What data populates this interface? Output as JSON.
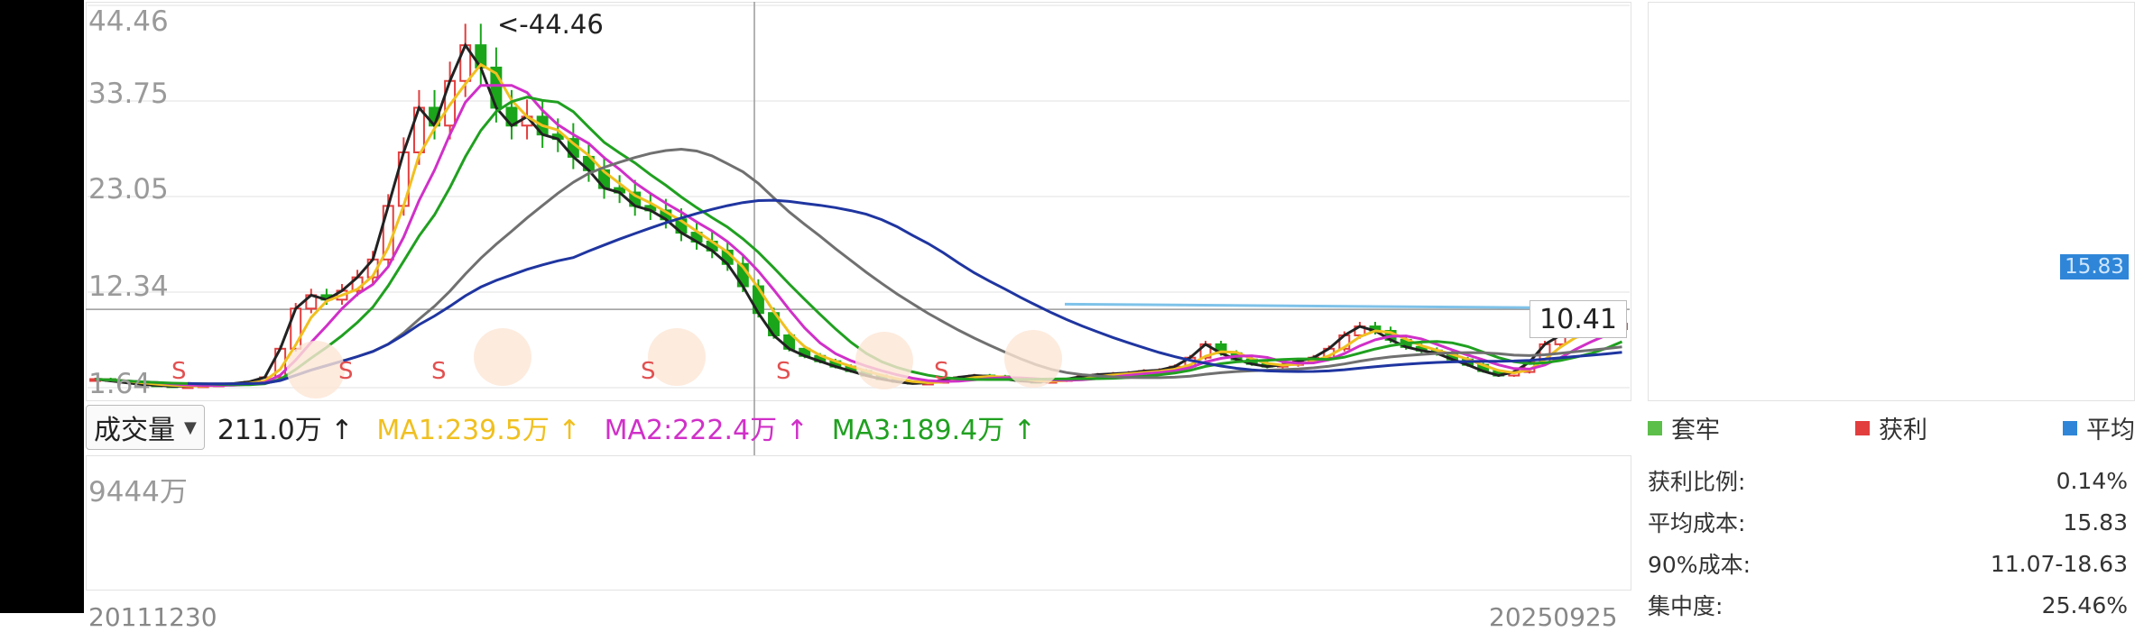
{
  "price_axis": {
    "ticks": [
      "44.46",
      "33.75",
      "23.05",
      "12.34",
      "1.64"
    ],
    "values": [
      44.46,
      33.75,
      23.05,
      12.34,
      1.64
    ]
  },
  "labels": {
    "high_marker": "<-44.46",
    "low_marker": "1.64->",
    "current_price": "10.41",
    "avg_cost_tag": "15.83"
  },
  "volume_toolbar": {
    "selector": "成交量",
    "vol": "211.0万 ↑",
    "ma1": "MA1:239.5万 ↑",
    "ma2": "MA2:222.4万 ↑",
    "ma3": "MA3:189.4万 ↑",
    "ma1_color": "#f0c020",
    "ma2_color": "#d030c8",
    "ma3_color": "#20a020"
  },
  "volume_axis": {
    "top": "9444万"
  },
  "dates": {
    "left": "20111230",
    "right": "20250925"
  },
  "chip": {
    "legend": [
      {
        "label": "套牢",
        "color": "#5cbf4a"
      },
      {
        "label": "获利",
        "color": "#e23e3e"
      },
      {
        "label": "平均",
        "color": "#2f86d8"
      }
    ],
    "stats": [
      {
        "label": "获利比例:",
        "value": "0.14%"
      },
      {
        "label": "平均成本:",
        "value": "15.83"
      },
      {
        "label": "90%成本:",
        "value": "11.07-18.63"
      },
      {
        "label": "集中度:",
        "value": "25.46%"
      }
    ]
  },
  "chart_data": {
    "type": "candlestick",
    "ylim": [
      1.64,
      44.46
    ],
    "high": 44.46,
    "low": 1.64,
    "current": 10.41,
    "avg_cost": 15.83,
    "close_series": [
      2.6,
      2.4,
      2.2,
      2.0,
      1.9,
      1.8,
      1.8,
      1.9,
      2.0,
      2.1,
      2.3,
      2.8,
      6.0,
      10.5,
      12.0,
      11.5,
      12.5,
      14.0,
      16.0,
      22.0,
      28.0,
      33.0,
      31.0,
      36.0,
      40.0,
      37.5,
      33.0,
      31.0,
      32.0,
      30.0,
      29.5,
      27.5,
      26.0,
      24.0,
      23.5,
      22.0,
      21.5,
      20.5,
      19.0,
      18.0,
      17.0,
      15.5,
      13.0,
      10.0,
      7.5,
      6.0,
      5.2,
      4.6,
      4.0,
      3.5,
      3.0,
      2.6,
      2.3,
      2.1,
      2.2,
      2.5,
      2.8,
      3.0,
      2.9,
      2.6,
      2.4,
      2.3,
      2.4,
      2.6,
      2.9,
      3.1,
      3.2,
      3.3,
      3.5,
      3.6,
      4.0,
      5.0,
      6.5,
      5.5,
      4.8,
      4.3,
      4.0,
      4.2,
      4.6,
      5.0,
      6.0,
      7.5,
      8.5,
      8.0,
      7.0,
      6.2,
      5.8,
      5.5,
      4.8,
      4.2,
      3.5,
      3.0,
      3.4,
      4.5,
      6.5,
      7.5,
      7.8,
      7.6,
      8.2,
      8.8
    ],
    "volume_series": [
      0.005,
      0.004,
      0.004,
      0.003,
      0.003,
      0.003,
      0.004,
      0.004,
      0.004,
      0.005,
      0.005,
      0.006,
      0.01,
      0.012,
      0.01,
      0.008,
      0.008,
      0.008,
      0.01,
      0.01,
      0.012,
      0.011,
      0.01,
      0.01,
      0.012,
      0.01,
      0.008,
      0.007,
      0.007,
      0.007,
      0.006,
      0.006,
      0.006,
      0.005,
      0.005,
      0.005,
      0.005,
      0.005,
      0.005,
      0.005,
      0.006,
      0.006,
      0.006,
      0.007,
      0.007,
      0.006,
      0.006,
      0.006,
      0.006,
      0.01,
      0.03,
      0.06,
      0.09,
      0.05,
      0.04,
      0.03,
      0.05,
      0.06,
      0.04,
      0.03,
      0.02,
      0.02,
      0.02,
      0.015,
      0.015,
      0.015,
      0.015,
      0.02,
      0.02,
      0.025,
      0.26,
      0.35,
      0.27,
      0.16,
      0.22,
      0.1,
      0.13,
      0.12,
      0.2,
      0.28,
      0.4,
      0.53,
      0.4,
      0.45,
      0.3,
      0.18,
      0.16,
      0.18,
      0.15,
      0.2,
      0.25,
      0.26,
      0.1,
      0.2,
      0.68,
      1.0,
      0.78,
      0.36,
      0.31,
      0.24
    ],
    "ma_series": [
      {
        "color": "#222222"
      },
      {
        "color": "#f0c020"
      },
      {
        "color": "#d030c8"
      },
      {
        "color": "#20a020"
      },
      {
        "color": "#707070"
      },
      {
        "color": "#1f35a0"
      }
    ]
  }
}
